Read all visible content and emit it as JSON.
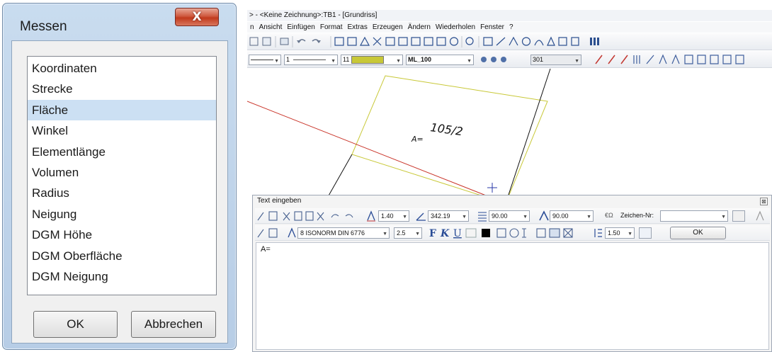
{
  "messen": {
    "title": "Messen",
    "close_glyph": "X",
    "items": [
      "Koordinaten",
      "Strecke",
      "Fläche",
      "Winkel",
      "Elementlänge",
      "Volumen",
      "Radius",
      "Neigung",
      "DGM Höhe",
      "DGM Oberfläche",
      "DGM Neigung"
    ],
    "selected_index": 2,
    "ok_label": "OK",
    "cancel_label": "Abbrechen"
  },
  "app": {
    "title": "> - <Keine Zeichnung>:TB1 - [Grundriss]",
    "menu": [
      "n",
      "Ansicht",
      "Einfügen",
      "Format",
      "Extras",
      "Erzeugen",
      "Ändern",
      "Wiederholen",
      "Fenster",
      "?"
    ],
    "toolbar2": {
      "pen_value": "1",
      "color_value": "11",
      "layer_value": "ML_100",
      "hatch_number": "301"
    },
    "accent_color": "#c8c837"
  },
  "canvas": {
    "parcel_label": "105/2",
    "area_label": "A="
  },
  "text_dialog": {
    "title": "Text eingeben",
    "close_glyph": "⊠",
    "row1": {
      "height_value": "1.40",
      "angle_value": "342.19",
      "width_value": "90.00",
      "slant_value": "90.00",
      "zeichen_label": "Zeichen-Nr:"
    },
    "row2": {
      "font_value": "8 ISONORM DIN 6776",
      "size_value": "2.5",
      "line_spacing_value": "1.50",
      "ok_label": "OK"
    },
    "content": "A="
  }
}
